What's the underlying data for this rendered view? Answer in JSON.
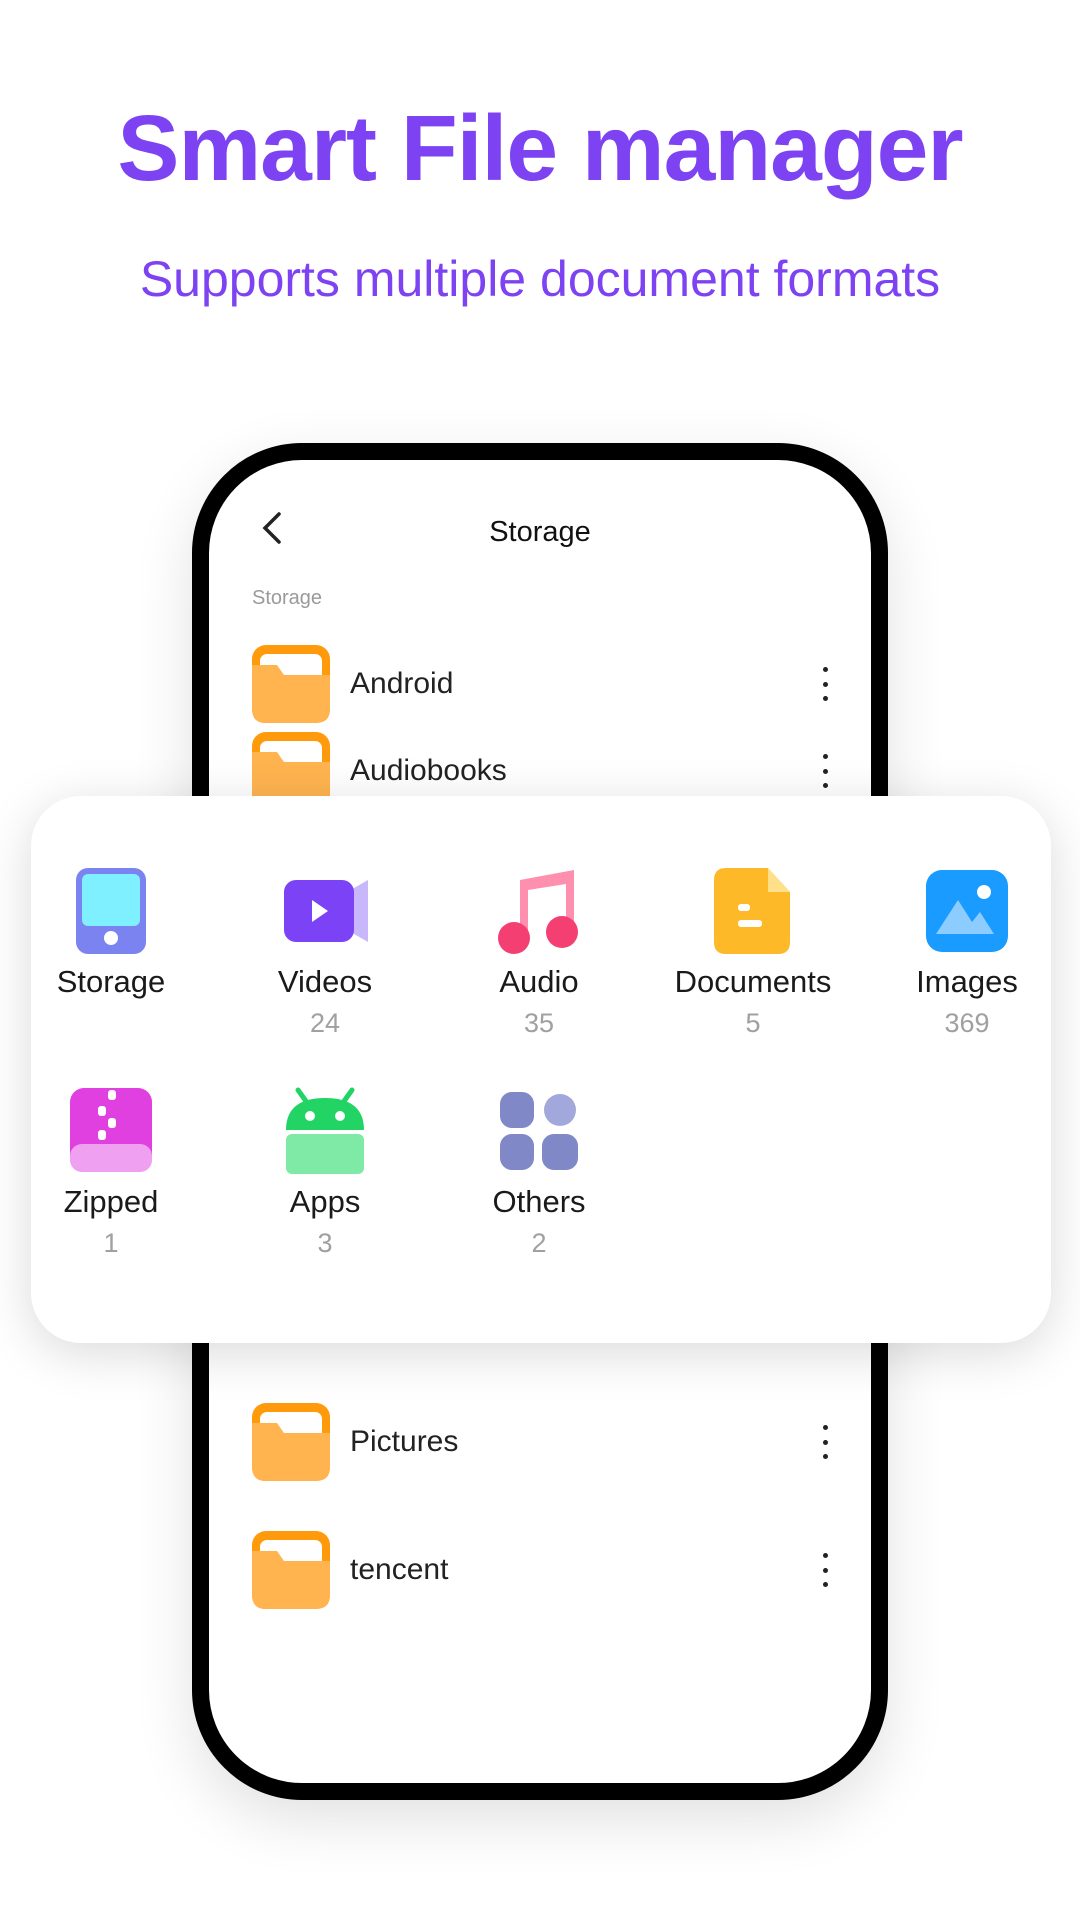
{
  "hero": {
    "title": "Smart File manager",
    "subtitle": "Supports multiple document formats"
  },
  "accent": "#7d43f3",
  "screen": {
    "header": {
      "title": "Storage",
      "back_icon": "chevron-left-icon"
    },
    "section_label": "Storage",
    "folders": [
      {
        "name": "Android"
      },
      {
        "name": "Audiobooks"
      },
      {
        "name": "Pictures"
      },
      {
        "name": "tencent"
      }
    ]
  },
  "categories": [
    {
      "label": "Storage",
      "count": ""
    },
    {
      "label": "Videos",
      "count": "24"
    },
    {
      "label": "Audio",
      "count": "35"
    },
    {
      "label": "Documents",
      "count": "5"
    },
    {
      "label": "Images",
      "count": "369"
    },
    {
      "label": "Zipped",
      "count": "1"
    },
    {
      "label": "Apps",
      "count": "3"
    },
    {
      "label": "Others",
      "count": "2"
    }
  ]
}
